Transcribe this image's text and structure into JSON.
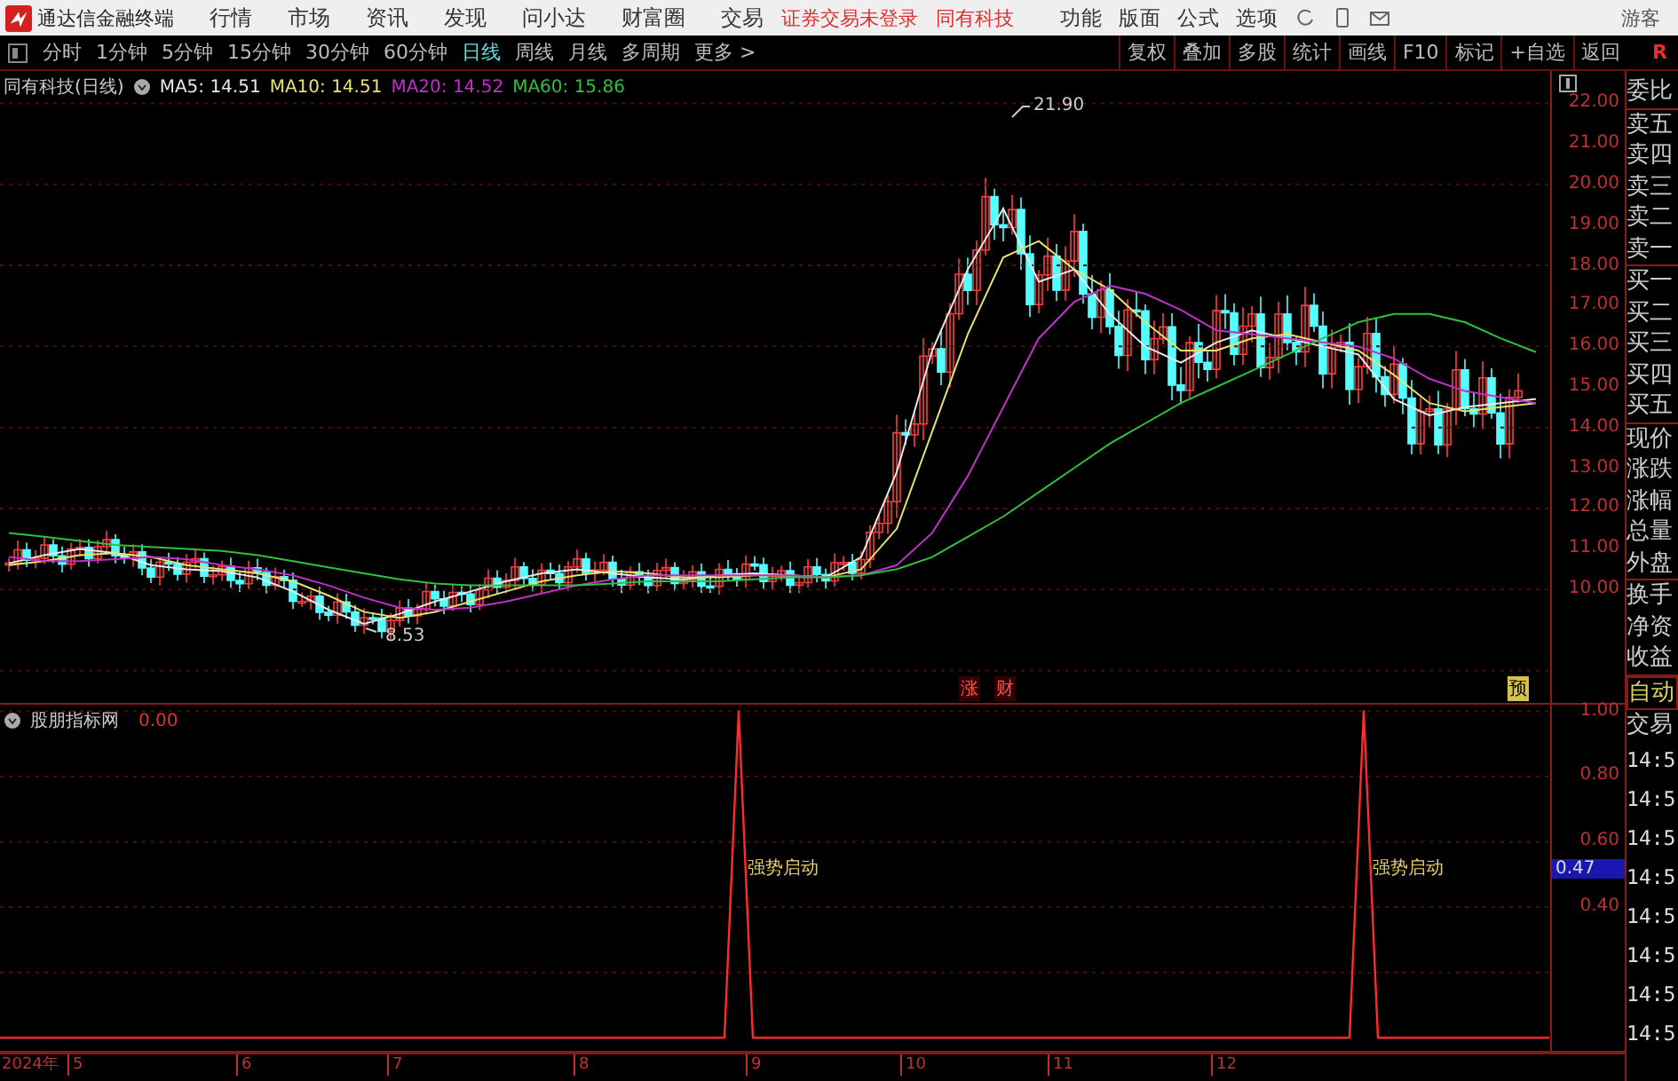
{
  "app": {
    "title": "通达信金融终端"
  },
  "menu": [
    "行情",
    "市场",
    "资讯",
    "发现",
    "问小达",
    "财富圈",
    "交易"
  ],
  "status": [
    "证券交易未登录",
    "同有科技"
  ],
  "tools": [
    "功能",
    "版面",
    "公式",
    "选项"
  ],
  "user": "游客",
  "periods": [
    {
      "label": "分时",
      "selected": false
    },
    {
      "label": "1分钟",
      "selected": false
    },
    {
      "label": "5分钟",
      "selected": false
    },
    {
      "label": "15分钟",
      "selected": false
    },
    {
      "label": "30分钟",
      "selected": false
    },
    {
      "label": "60分钟",
      "selected": false
    },
    {
      "label": "日线",
      "selected": true
    },
    {
      "label": "周线",
      "selected": false
    },
    {
      "label": "月线",
      "selected": false
    },
    {
      "label": "多周期",
      "selected": false
    },
    {
      "label": "更多 >",
      "selected": false
    }
  ],
  "actions": [
    "复权",
    "叠加",
    "多股",
    "统计",
    "画线",
    "F10",
    "标记",
    "+自选",
    "返回"
  ],
  "r_label": "R",
  "chart": {
    "title": "同有科技(日线)",
    "chart_data": {
      "type": "line",
      "grid": true,
      "ylim": [
        7.2,
        22.8
      ],
      "yticks": [
        {
          "value": 22,
          "label": "22.00"
        },
        {
          "value": 21,
          "label": "21.00"
        },
        {
          "value": 20,
          "label": "20.00"
        },
        {
          "value": 19,
          "label": "19.00"
        },
        {
          "value": 18,
          "label": "18.00"
        },
        {
          "value": 17,
          "label": "17.00"
        },
        {
          "value": 16,
          "label": "16.00"
        },
        {
          "value": 15,
          "label": "15.00"
        },
        {
          "value": 14,
          "label": "14.00"
        },
        {
          "value": 13,
          "label": "13.00"
        },
        {
          "value": 12,
          "label": "12.00"
        },
        {
          "value": 11,
          "label": "11.00"
        },
        {
          "value": 10,
          "label": "10.00"
        }
      ],
      "series": [
        {
          "name": "MA5: 14.51",
          "color": "#e8e8e8",
          "values": [
            10.65,
            10.85,
            11.0,
            10.9,
            10.6,
            10.5,
            10.45,
            10.3,
            9.95,
            9.5,
            9.15,
            9.4,
            9.7,
            9.95,
            10.2,
            10.4,
            10.5,
            10.4,
            10.3,
            10.25,
            10.35,
            10.4,
            10.35,
            10.3,
            10.8,
            12.9,
            15.9,
            17.9,
            19.4,
            17.6,
            17.9,
            16.8,
            16.0,
            15.6,
            16.1,
            16.4,
            16.2,
            16.0,
            15.8,
            14.7,
            14.3,
            14.5,
            14.6,
            14.7
          ]
        },
        {
          "name": "MA10: 14.51",
          "color": "#e8e070",
          "values": [
            10.6,
            10.7,
            10.85,
            10.9,
            10.8,
            10.6,
            10.5,
            10.4,
            10.2,
            9.85,
            9.45,
            9.3,
            9.45,
            9.7,
            9.95,
            10.2,
            10.35,
            10.45,
            10.4,
            10.3,
            10.3,
            10.35,
            10.35,
            10.3,
            10.5,
            11.5,
            13.9,
            16.3,
            18.2,
            18.6,
            17.9,
            17.4,
            16.6,
            15.9,
            15.9,
            16.2,
            16.3,
            16.1,
            15.9,
            15.3,
            14.6,
            14.4,
            14.5,
            14.6
          ]
        },
        {
          "name": "MA20: 14.52",
          "color": "#c030c8",
          "values": [
            10.8,
            10.7,
            10.7,
            10.75,
            10.8,
            10.75,
            10.6,
            10.5,
            10.35,
            10.1,
            9.8,
            9.55,
            9.5,
            9.55,
            9.7,
            9.9,
            10.1,
            10.25,
            10.35,
            10.35,
            10.35,
            10.35,
            10.35,
            10.3,
            10.35,
            10.6,
            11.4,
            12.8,
            14.5,
            16.2,
            17.1,
            17.5,
            17.3,
            16.9,
            16.4,
            16.3,
            16.2,
            16.1,
            16.0,
            15.7,
            15.2,
            14.9,
            14.75,
            14.6
          ]
        },
        {
          "name": "MA60: 15.86",
          "color": "#30c040",
          "values": [
            11.4,
            11.3,
            11.2,
            11.1,
            11.05,
            11.0,
            10.95,
            10.85,
            10.7,
            10.55,
            10.4,
            10.25,
            10.15,
            10.1,
            10.1,
            10.1,
            10.1,
            10.15,
            10.2,
            10.2,
            10.2,
            10.25,
            10.3,
            10.3,
            10.35,
            10.5,
            10.8,
            11.3,
            11.8,
            12.4,
            13.0,
            13.6,
            14.1,
            14.6,
            15.0,
            15.4,
            15.8,
            16.2,
            16.6,
            16.8,
            16.8,
            16.6,
            16.2,
            15.86
          ]
        }
      ]
    },
    "high_label": "21.90",
    "low_label": "8.53",
    "markers": [
      "涨",
      "财"
    ],
    "marker_right": "预"
  },
  "indicator": {
    "name": "股朋指标网",
    "value": "0.00",
    "current": "0.47",
    "signals": [
      "强势启动",
      "强势启动"
    ],
    "chart_data": {
      "type": "line",
      "grid": true,
      "ylim": [
        -0.04,
        1.02
      ],
      "yticks": [
        {
          "value": 1,
          "label": "1.00"
        },
        {
          "value": 0.8,
          "label": "0.80"
        },
        {
          "value": 0.6,
          "label": "0.60"
        },
        {
          "value": 0.4,
          "label": "0.40"
        }
      ],
      "series": [
        {
          "color": "#ff2a2a",
          "values": [
            0,
            0,
            0,
            0,
            0,
            0,
            0,
            0,
            0,
            0,
            0,
            0,
            0,
            0,
            0,
            0,
            0,
            0,
            0,
            0,
            0,
            0,
            0,
            0,
            0,
            0,
            0,
            0,
            0,
            0,
            0,
            0,
            0,
            0,
            0,
            0,
            0,
            0,
            0,
            0,
            0,
            0,
            0,
            0,
            0,
            0,
            0,
            0,
            0,
            0,
            0,
            0,
            1,
            0,
            0,
            0,
            0,
            0,
            0,
            0,
            0,
            0,
            0,
            0,
            0,
            0,
            0,
            0,
            0,
            0,
            0,
            0,
            0,
            0,
            0,
            0,
            0,
            0,
            0,
            0,
            0,
            0,
            0,
            0,
            0,
            0,
            0,
            0,
            0,
            0,
            0,
            0,
            0,
            0,
            0,
            0,
            1,
            0,
            0,
            0,
            0,
            0,
            0,
            0,
            0,
            0,
            0,
            0,
            0,
            0
          ]
        }
      ]
    }
  },
  "x_axis": {
    "year": "2024年",
    "months": [
      "5",
      "6",
      "7",
      "8",
      "9",
      "10",
      "11",
      "12"
    ]
  },
  "side_panel": {
    "sections": [
      [
        "委比"
      ],
      [
        "卖五",
        "卖四",
        "卖三",
        "卖二",
        "卖一"
      ],
      [
        "买一",
        "买二",
        "买三",
        "买四",
        "买五"
      ],
      [
        "现价",
        "涨跌",
        "涨幅",
        "总量",
        "外盘"
      ],
      [
        "换手",
        "净资",
        "收益"
      ]
    ],
    "auto": "自动",
    "trade": "交易",
    "times": [
      "14:5",
      "14:5",
      "14:5",
      "14:5",
      "14:5",
      "14:5",
      "14:5",
      "14:5"
    ]
  }
}
